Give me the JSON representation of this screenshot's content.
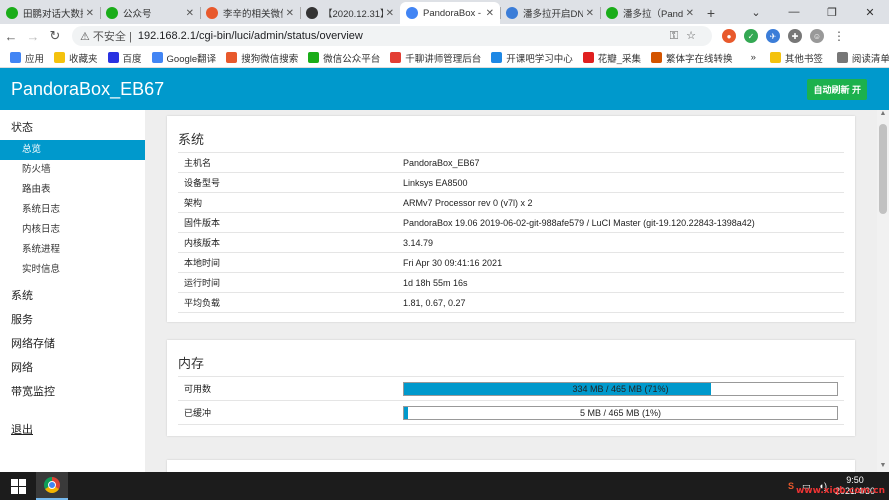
{
  "browser": {
    "tabs": [
      {
        "title": "田鹏对话大数据",
        "color": "#1aad19",
        "icon": "wechat-icon"
      },
      {
        "title": "公众号",
        "color": "#1aad19",
        "icon": "wechat-icon"
      },
      {
        "title": "李辛的相关微信",
        "color": "#e8592c",
        "icon": "sogou-icon"
      },
      {
        "title": "【2020.12.31】",
        "color": "#333333",
        "icon": "page-icon"
      },
      {
        "title": "PandoraBox - ",
        "color": "#4285f4",
        "icon": "router-icon",
        "active": true
      },
      {
        "title": "潘多拉开启DN",
        "color": "#3b7dd8",
        "icon": "bird-icon"
      },
      {
        "title": "潘多拉（Pand",
        "color": "#1aad19",
        "icon": "leaf-icon"
      }
    ],
    "newtab": "+",
    "window_controls": [
      "⌄",
      "—",
      "❐",
      "✕"
    ],
    "insecure_label": "不安全",
    "url": "192.168.2.1/cgi-bin/luci/admin/status/overview",
    "bookmarks": [
      {
        "label": "应用",
        "color": "#4285f4"
      },
      {
        "label": "收藏夹",
        "color": "#f4c20d"
      },
      {
        "label": "百度",
        "color": "#2932e1"
      },
      {
        "label": "Google翻译",
        "color": "#4285f4"
      },
      {
        "label": "搜狗微信搜索",
        "color": "#e8592c"
      },
      {
        "label": "微信公众平台",
        "color": "#1aad19"
      },
      {
        "label": "千聊讲师管理后台",
        "color": "#e33e33"
      },
      {
        "label": "开课吧学习中心",
        "color": "#1e88e5"
      },
      {
        "label": "花瓣_采集",
        "color": "#e02020"
      },
      {
        "label": "繁体字在线转换",
        "color": "#d35400"
      }
    ],
    "bookmarks_more": "»",
    "other_bookmarks": "其他书签",
    "reading_list": "阅读清单"
  },
  "header": {
    "brand": "PandoraBox_EB67",
    "refresh_button": "自动刷新 开",
    "accent": "#0099cc"
  },
  "sidebar": {
    "status": "状态",
    "status_items": [
      "总览",
      "防火墙",
      "路由表",
      "系统日志",
      "内核日志",
      "系统进程",
      "实时信息"
    ],
    "active_index": 0,
    "categories": [
      "系统",
      "服务",
      "网络存储",
      "网络",
      "带宽监控"
    ],
    "logout": "退出"
  },
  "system": {
    "title": "系统",
    "rows": [
      {
        "k": "主机名",
        "v": "PandoraBox_EB67"
      },
      {
        "k": "设备型号",
        "v": "Linksys EA8500"
      },
      {
        "k": "架构",
        "v": "ARMv7 Processor rev 0 (v7l) x 2"
      },
      {
        "k": "固件版本",
        "v": "PandoraBox 19.06 2019-06-02-git-988afe579 / LuCI Master (git-19.120.22843-1398a42)"
      },
      {
        "k": "内核版本",
        "v": "3.14.79"
      },
      {
        "k": "本地时间",
        "v": "Fri Apr 30 09:41:16 2021"
      },
      {
        "k": "运行时间",
        "v": "1d 18h 55m 16s"
      },
      {
        "k": "平均负载",
        "v": "1.81, 0.67, 0.27"
      }
    ]
  },
  "memory": {
    "title": "内存",
    "rows": [
      {
        "k": "可用数",
        "text": "334 MB / 465 MB (71%)",
        "fraction": 0.71
      },
      {
        "k": "已缓冲",
        "text": "5 MB / 465 MB (1%)",
        "fraction": 0.01
      }
    ]
  },
  "taskbar": {
    "time": "9:50",
    "date": "2021/4/30"
  },
  "watermark": "www.xiqb.com.cn"
}
